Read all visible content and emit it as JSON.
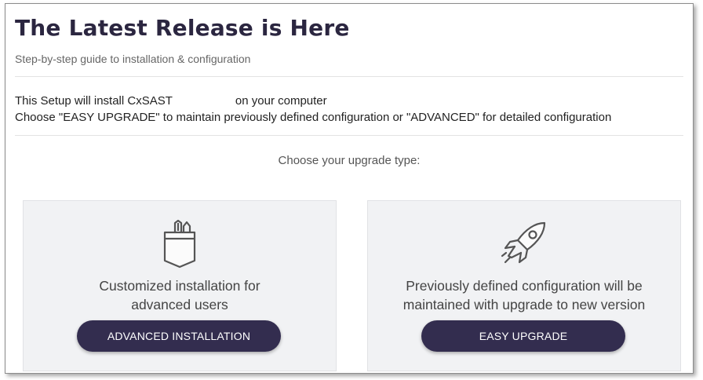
{
  "header": {
    "title": "The Latest Release is Here",
    "subtitle": "Step-by-step guide to installation & configuration"
  },
  "info": {
    "line1_prefix": "This Setup will install CxSAST",
    "line1_suffix": "on your computer",
    "line2": "Choose \"EASY UPGRADE\" to maintain previously defined configuration or \"ADVANCED\" for detailed configuration"
  },
  "prompt": "Choose your upgrade type:",
  "options": {
    "advanced": {
      "icon": "pocket-tools-icon",
      "line1": "Customized installation for",
      "line2": "advanced users",
      "button": "ADVANCED INSTALLATION"
    },
    "easy": {
      "icon": "rocket-icon",
      "line1": "Previously defined configuration will be",
      "line2": "maintained with upgrade to new version",
      "button": "EASY UPGRADE"
    }
  },
  "colors": {
    "accent": "#332d4f",
    "title": "#2b2640",
    "panel": "#f1f2f4"
  }
}
